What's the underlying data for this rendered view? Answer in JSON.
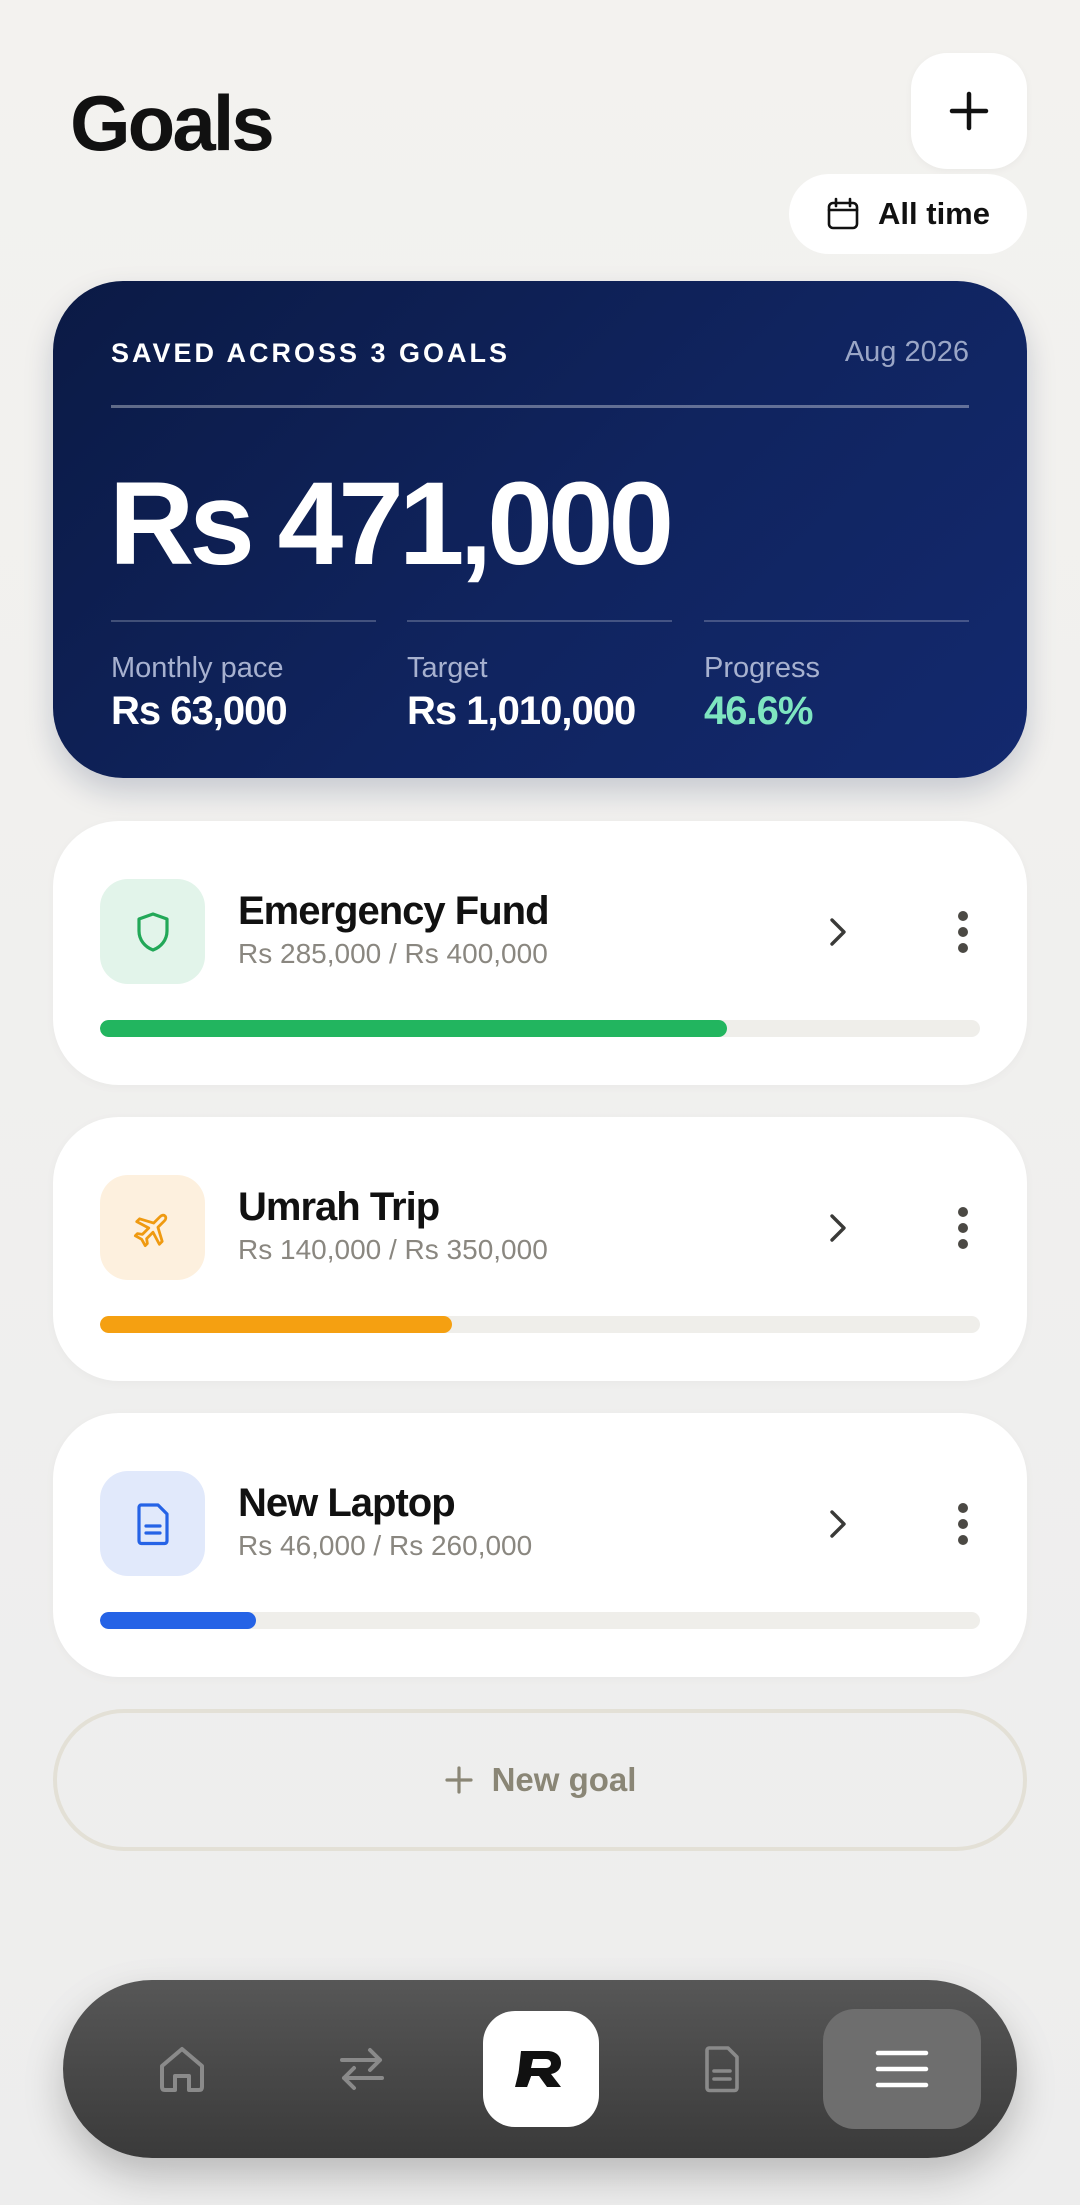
{
  "header": {
    "title": "Goals",
    "period_label": "All time"
  },
  "summary": {
    "label": "SAVED ACROSS 3 GOALS",
    "date": "Aug 2026",
    "total": "Rs 471,000",
    "stats": [
      {
        "key": "Monthly pace",
        "value": "Rs 63,000"
      },
      {
        "key": "Target",
        "value": "Rs 1,010,000"
      },
      {
        "key": "Progress",
        "value": "46.6%"
      }
    ]
  },
  "goals": [
    {
      "name": "Emergency Fund",
      "amounts": "Rs 285,000 / Rs 400,000",
      "progress": 0.7125,
      "color": "#22b55f",
      "icon": "shield-icon",
      "icon_bg": "#e2f4ea"
    },
    {
      "name": "Umrah Trip",
      "amounts": "Rs 140,000 / Rs 350,000",
      "progress": 0.4,
      "color": "#f5a011",
      "icon": "airplane-icon",
      "icon_bg": "#fdf0de"
    },
    {
      "name": "New Laptop",
      "amounts": "Rs 46,000 / Rs 260,000",
      "progress": 0.177,
      "color": "#2563e6",
      "icon": "document-icon",
      "icon_bg": "#e1e9fb"
    }
  ],
  "new_goal_label": "New goal",
  "nav": {
    "items": [
      "home-icon",
      "transfer-icon",
      "brand-logo",
      "document-icon",
      "menu-icon"
    ],
    "active": "menu-icon"
  },
  "colors": {
    "summary_bg": "#0e2159",
    "progress_accent": "#7ee5c0",
    "page_bg": "#f3f2ef"
  }
}
